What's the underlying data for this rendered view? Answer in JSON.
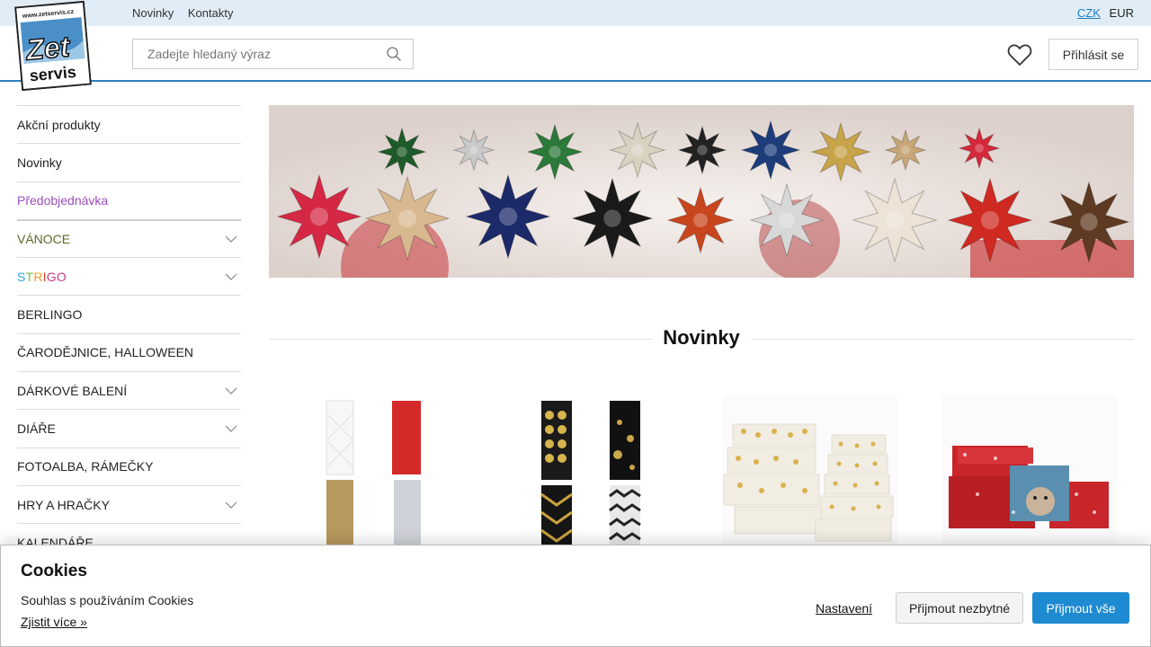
{
  "topbar": {
    "links": [
      "Novinky",
      "Kontakty"
    ],
    "currency": {
      "active": "CZK",
      "other": "EUR"
    }
  },
  "header": {
    "logo": {
      "url_text": "www.zetservis.cz",
      "line1": "Zet",
      "line2": "servis"
    },
    "search_placeholder": "Zadejte hledaný výraz",
    "login_label": "Přihlásit se"
  },
  "sidebar": {
    "items": [
      {
        "label": "Akční produkty",
        "has_sub": false
      },
      {
        "label": "Novinky",
        "has_sub": false
      },
      {
        "label": "Předobjednávka",
        "has_sub": false
      },
      {
        "label": "VÁNOCE",
        "has_sub": true
      },
      {
        "label": "STRIGO",
        "has_sub": true
      },
      {
        "label": "BERLINGO",
        "has_sub": false
      },
      {
        "label": "ČARODĚJNICE, HALLOWEEN",
        "has_sub": false
      },
      {
        "label": "DÁRKOVÉ BALENÍ",
        "has_sub": true
      },
      {
        "label": "DIÁŘE",
        "has_sub": true
      },
      {
        "label": "FOTOALBA, RÁMEČKY",
        "has_sub": false
      },
      {
        "label": "HRY A HRAČKY",
        "has_sub": true
      },
      {
        "label": "KALENDÁŘE",
        "has_sub": false
      }
    ]
  },
  "main": {
    "section_title": "Novinky"
  },
  "cookie": {
    "title": "Cookies",
    "text": "Souhlas s používáním Cookies",
    "more_link": "Zjistit více »",
    "settings_link": "Nastavení",
    "accept_necessary": "Přijmout nezbytné",
    "accept_all": "Přijmout vše"
  },
  "colors": {
    "accent": "#1d8ad1",
    "topbar_bg": "#e1edf6",
    "preorder": "#9b4fb8",
    "header_border": "#2f7fbe"
  }
}
